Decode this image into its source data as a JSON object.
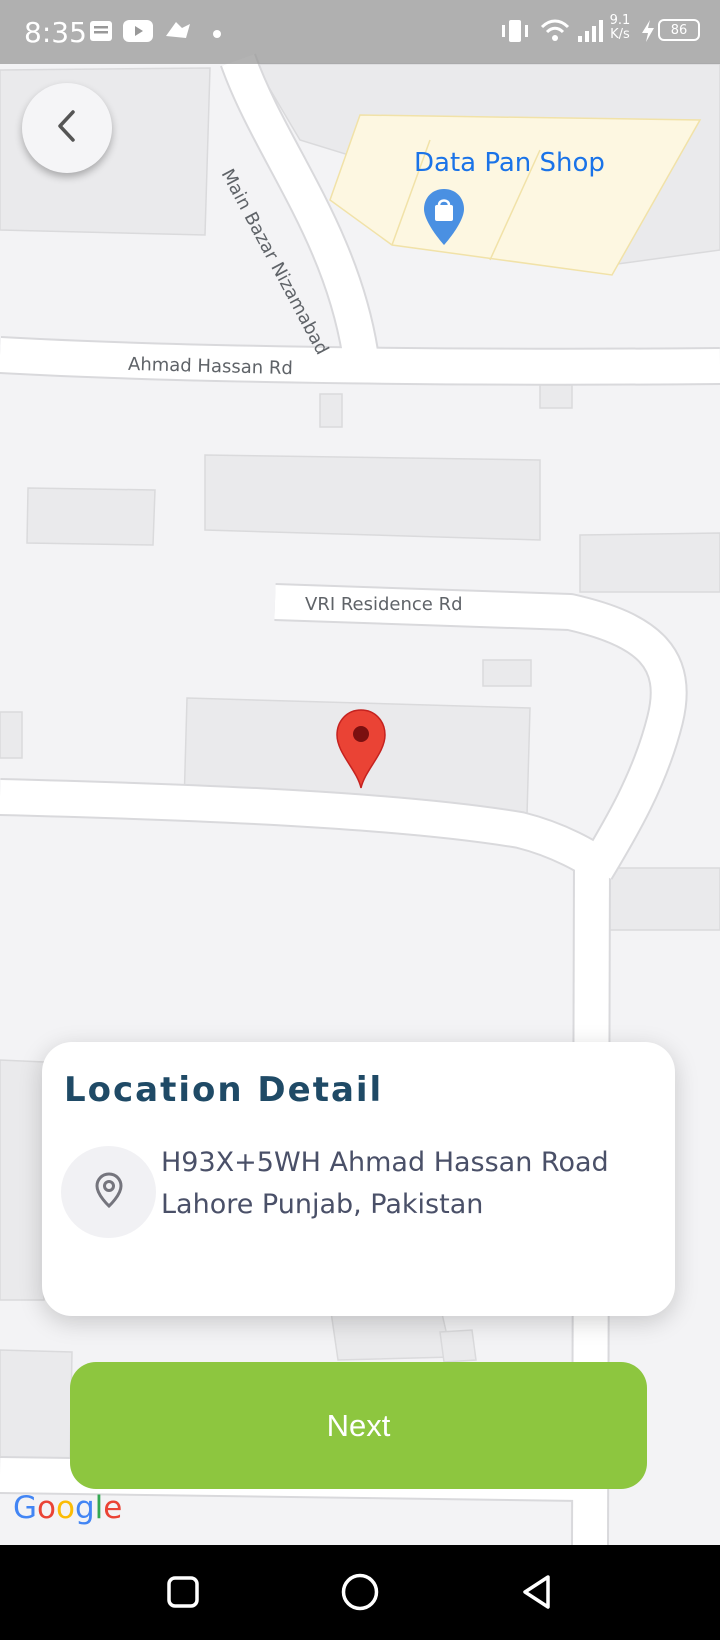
{
  "status_bar": {
    "time": "8:35",
    "net_speed_value": "9.1",
    "net_speed_unit": "K/s",
    "battery": "86",
    "icons": [
      "notification-icon",
      "youtube-icon",
      "game-icon",
      "dot-icon",
      "vibrate-icon",
      "wifi-icon",
      "signal-icon",
      "charging-icon",
      "battery-icon"
    ]
  },
  "map": {
    "roads": {
      "main_bazar": "Main Bazar Nizamabad",
      "ahmad_hassan": "Ahmad Hassan Rd",
      "vri_residence": "VRI Residence Rd"
    },
    "poi": {
      "name": "Data Pan Shop",
      "icon": "shopping-bag-icon"
    },
    "pin_icon": "location-pin-icon",
    "attribution": [
      "G",
      "o",
      "o",
      "g",
      "l",
      "e"
    ],
    "attribution_colors": [
      "#4285F4",
      "#EA4335",
      "#FBBC05",
      "#4285F4",
      "#34A853",
      "#EA4335"
    ]
  },
  "back_button": {
    "icon": "chevron-left-icon"
  },
  "location_card": {
    "title": "Location Detail",
    "address_line1": "H93X+5WH Ahmad Hassan Road",
    "address_line2": "Lahore Punjab, Pakistan",
    "icon": "map-pin-outline-icon"
  },
  "next_button": {
    "label": "Next",
    "color": "#8DC63F"
  },
  "nav_bar": {
    "buttons": [
      "recents-icon",
      "home-icon",
      "back-icon"
    ]
  }
}
